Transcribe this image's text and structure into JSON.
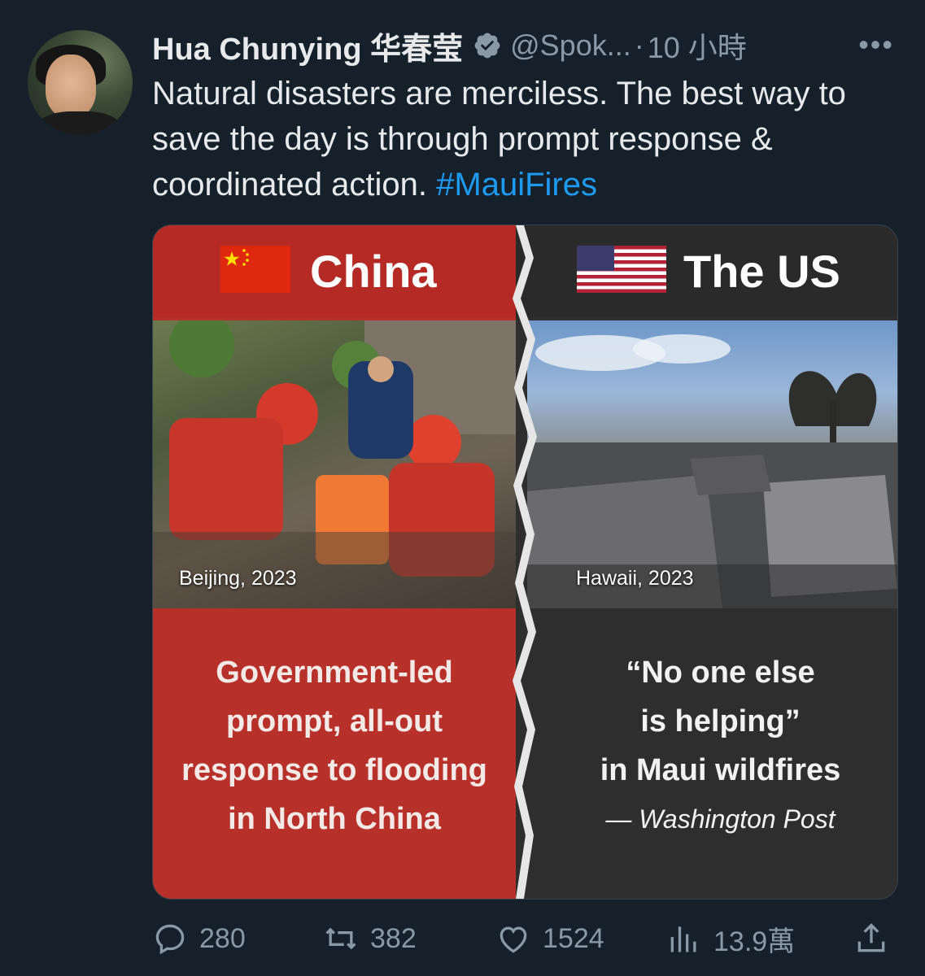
{
  "author": {
    "name": "Hua Chunying 华春莹",
    "handle": "@Spok...",
    "separator": "·",
    "time": "10 小時",
    "more": "•••"
  },
  "tweet": {
    "text": "Natural disasters are merciless. The best way to save the day is through prompt response & coordinated action.",
    "hashtag": "#MauiFires"
  },
  "card": {
    "left": {
      "country": "China",
      "caption": "Beijing, 2023",
      "lines": [
        "Government-led",
        "prompt, all-out",
        "response to flooding",
        "in North China"
      ]
    },
    "right": {
      "country": "The US",
      "caption": "Hawaii, 2023",
      "lines": [
        "“No one else",
        "is helping”",
        "in Maui wildfires"
      ],
      "source": "— Washington Post"
    }
  },
  "actions": {
    "replies": "280",
    "reposts": "382",
    "likes": "1524",
    "views": "13.9萬"
  },
  "colors": {
    "background": "#15202b",
    "accent": "#1d9bf0",
    "china_red": "#b52a24",
    "us_dark": "#2a2a2a"
  },
  "icons": [
    "verified-badge-icon",
    "more-icon",
    "reply-icon",
    "repost-icon",
    "like-icon",
    "views-icon",
    "share-icon"
  ]
}
